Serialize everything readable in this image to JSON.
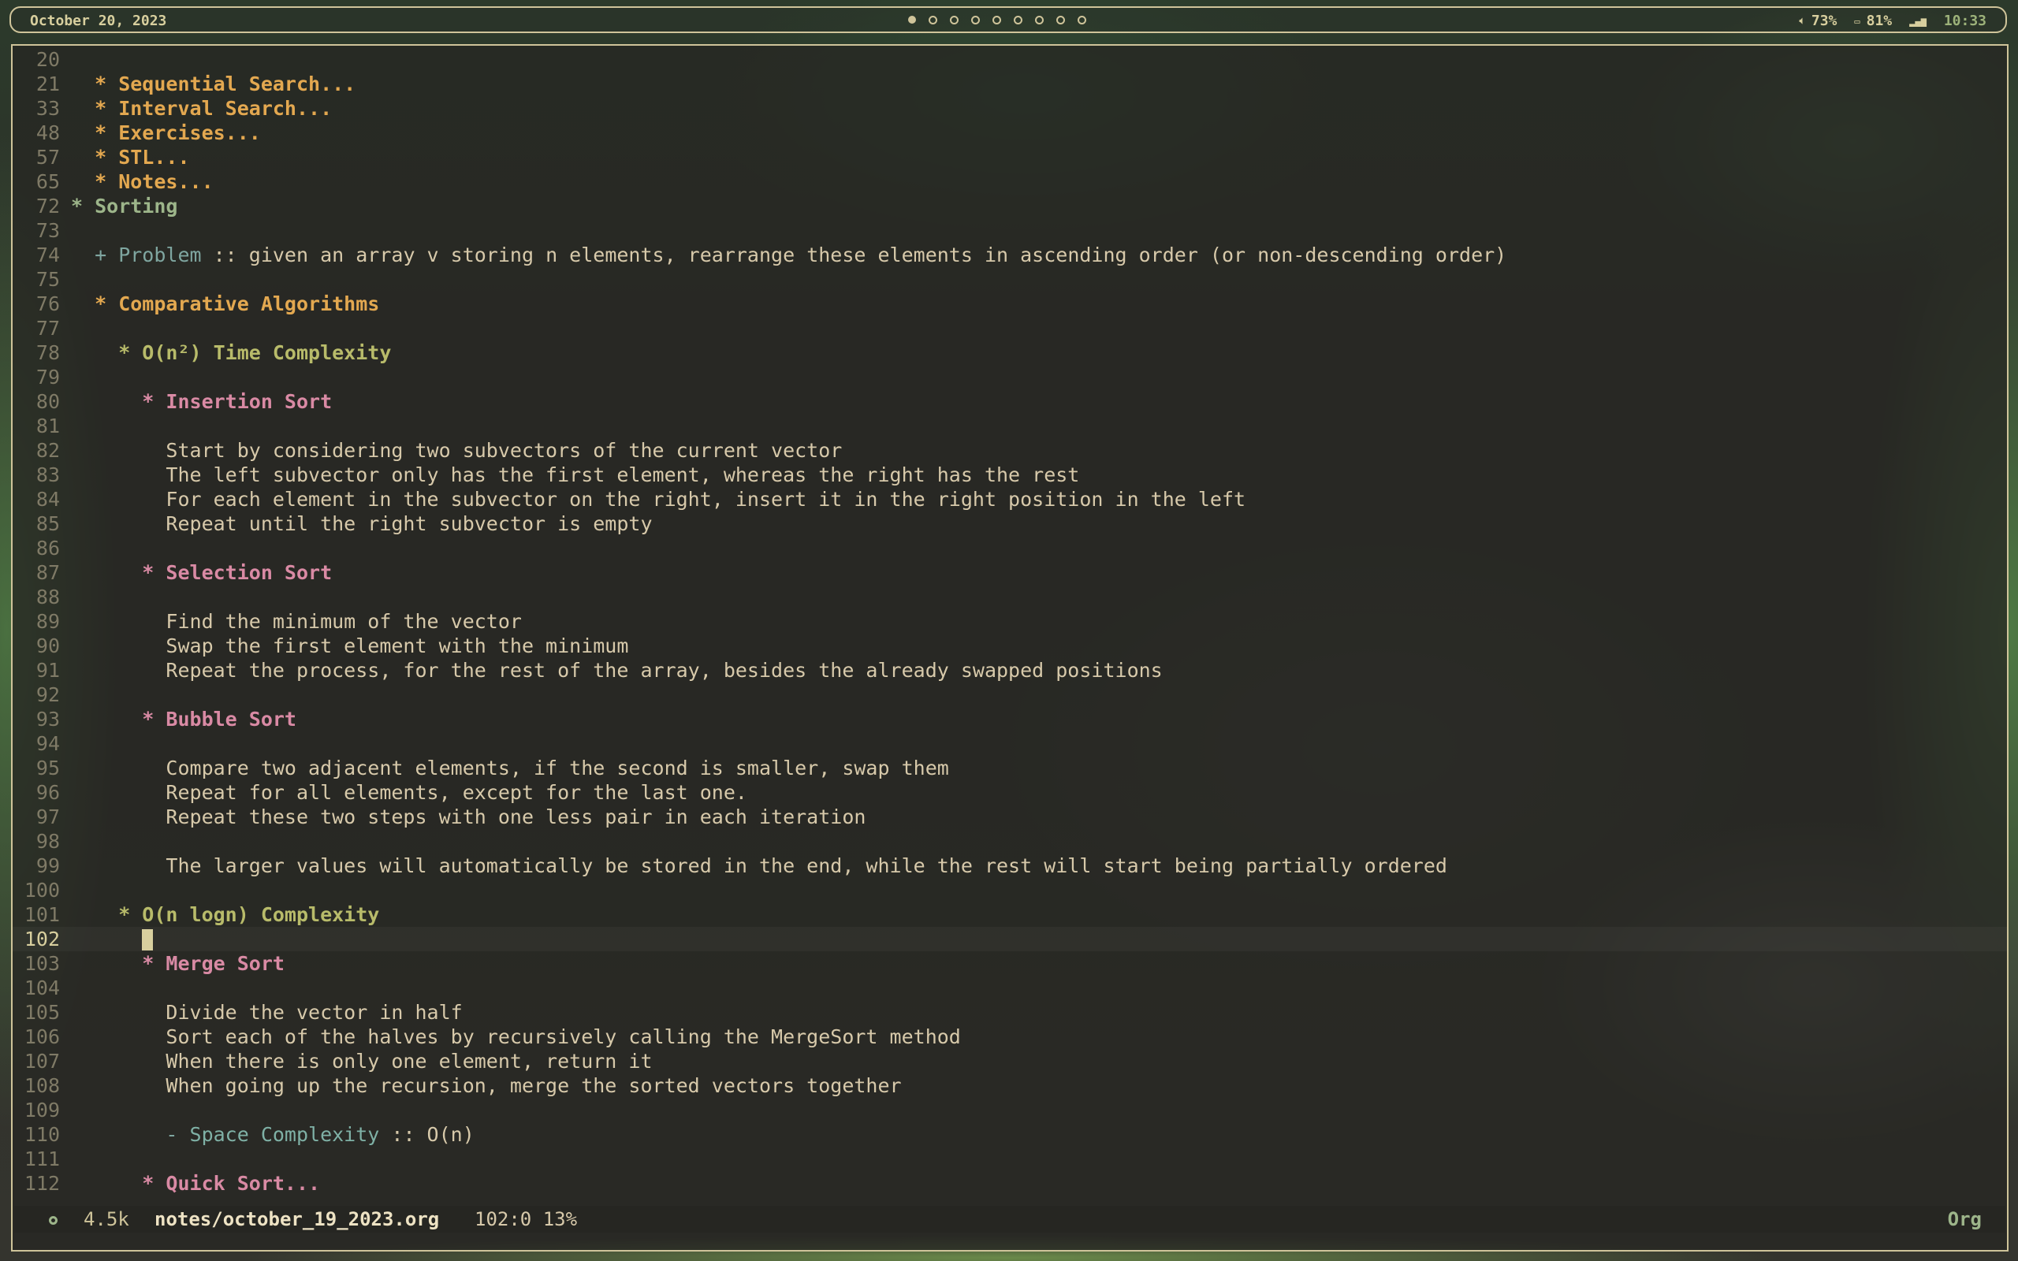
{
  "topbar": {
    "date": "October 20, 2023",
    "workspaces": [
      true,
      false,
      false,
      false,
      false,
      false,
      false,
      false,
      false
    ],
    "volume_icon": "speaker-icon",
    "volume": "73%",
    "battery_icon": "battery-icon",
    "battery": "81%",
    "signal_icon": "signal-icon",
    "clock": "10:33"
  },
  "editor": {
    "lines": [
      {
        "n": "20",
        "parts": []
      },
      {
        "n": "21",
        "parts": [
          [
            "h2",
            "  * Sequential Search..."
          ]
        ]
      },
      {
        "n": "33",
        "parts": [
          [
            "h2",
            "  * Interval Search..."
          ]
        ]
      },
      {
        "n": "48",
        "parts": [
          [
            "h2",
            "  * Exercises..."
          ]
        ]
      },
      {
        "n": "57",
        "parts": [
          [
            "h2",
            "  * STL..."
          ]
        ]
      },
      {
        "n": "65",
        "parts": [
          [
            "h2",
            "  * Notes..."
          ]
        ]
      },
      {
        "n": "72",
        "parts": [
          [
            "h1",
            "* Sorting"
          ]
        ]
      },
      {
        "n": "73",
        "parts": []
      },
      {
        "n": "74",
        "parts": [
          [
            "plus",
            "  + Problem"
          ],
          [
            "plain",
            " :: given an array v storing n elements, rearrange these elements in ascending order (or non-descending order)"
          ]
        ]
      },
      {
        "n": "75",
        "parts": []
      },
      {
        "n": "76",
        "parts": [
          [
            "h2",
            "  * Comparative Algorithms"
          ]
        ]
      },
      {
        "n": "77",
        "parts": []
      },
      {
        "n": "78",
        "parts": [
          [
            "h3",
            "    * O(n²) Time Complexity"
          ]
        ]
      },
      {
        "n": "79",
        "parts": []
      },
      {
        "n": "80",
        "parts": [
          [
            "h4",
            "      * Insertion Sort"
          ]
        ]
      },
      {
        "n": "81",
        "parts": []
      },
      {
        "n": "82",
        "parts": [
          [
            "plain",
            "        Start by considering two subvectors of the current vector"
          ]
        ]
      },
      {
        "n": "83",
        "parts": [
          [
            "plain",
            "        The left subvector only has the first element, whereas the right has the rest"
          ]
        ]
      },
      {
        "n": "84",
        "parts": [
          [
            "plain",
            "        For each element in the subvector on the right, insert it in the right position in the left"
          ]
        ]
      },
      {
        "n": "85",
        "parts": [
          [
            "plain",
            "        Repeat until the right subvector is empty"
          ]
        ]
      },
      {
        "n": "86",
        "parts": []
      },
      {
        "n": "87",
        "parts": [
          [
            "h4",
            "      * Selection Sort"
          ]
        ]
      },
      {
        "n": "88",
        "parts": []
      },
      {
        "n": "89",
        "parts": [
          [
            "plain",
            "        Find the minimum of the vector"
          ]
        ]
      },
      {
        "n": "90",
        "parts": [
          [
            "plain",
            "        Swap the first element with the minimum"
          ]
        ]
      },
      {
        "n": "91",
        "parts": [
          [
            "plain",
            "        Repeat the process, for the rest of the array, besides the already swapped positions"
          ]
        ]
      },
      {
        "n": "92",
        "parts": []
      },
      {
        "n": "93",
        "parts": [
          [
            "h4",
            "      * Bubble Sort"
          ]
        ]
      },
      {
        "n": "94",
        "parts": []
      },
      {
        "n": "95",
        "parts": [
          [
            "plain",
            "        Compare two adjacent elements, if the second is smaller, swap them"
          ]
        ]
      },
      {
        "n": "96",
        "parts": [
          [
            "plain",
            "        Repeat for all elements, except for the last one."
          ]
        ]
      },
      {
        "n": "97",
        "parts": [
          [
            "plain",
            "        Repeat these two steps with one less pair in each iteration"
          ]
        ]
      },
      {
        "n": "98",
        "parts": []
      },
      {
        "n": "99",
        "parts": [
          [
            "plain",
            "        The larger values will automatically be stored in the end, while the rest will start being partially ordered"
          ]
        ]
      },
      {
        "n": "100",
        "parts": []
      },
      {
        "n": "101",
        "parts": [
          [
            "h3",
            "    * O(n logn) Complexity"
          ]
        ]
      },
      {
        "n": "102",
        "parts": [
          [
            "plain",
            "      "
          ],
          [
            "cursor",
            ""
          ]
        ],
        "current": true
      },
      {
        "n": "103",
        "parts": [
          [
            "h4",
            "      * Merge Sort"
          ]
        ]
      },
      {
        "n": "104",
        "parts": []
      },
      {
        "n": "105",
        "parts": [
          [
            "plain",
            "        Divide the vector in half"
          ]
        ]
      },
      {
        "n": "106",
        "parts": [
          [
            "plain",
            "        Sort each of the halves by recursively calling the MergeSort method"
          ]
        ]
      },
      {
        "n": "107",
        "parts": [
          [
            "plain",
            "        When there is only one element, return it"
          ]
        ]
      },
      {
        "n": "108",
        "parts": [
          [
            "plain",
            "        When going up the recursion, merge the sorted vectors together"
          ]
        ]
      },
      {
        "n": "109",
        "parts": []
      },
      {
        "n": "110",
        "parts": [
          [
            "dash",
            "        - "
          ],
          [
            "term",
            "Space Complexity"
          ],
          [
            "plain",
            " :: O(n)"
          ]
        ]
      },
      {
        "n": "111",
        "parts": []
      },
      {
        "n": "112",
        "parts": [
          [
            "h4",
            "      * Quick Sort..."
          ]
        ]
      }
    ]
  },
  "modeline": {
    "size": "4.5k",
    "file": "notes/october_19_2023.org",
    "position": "102:0 13%",
    "mode": "Org"
  }
}
